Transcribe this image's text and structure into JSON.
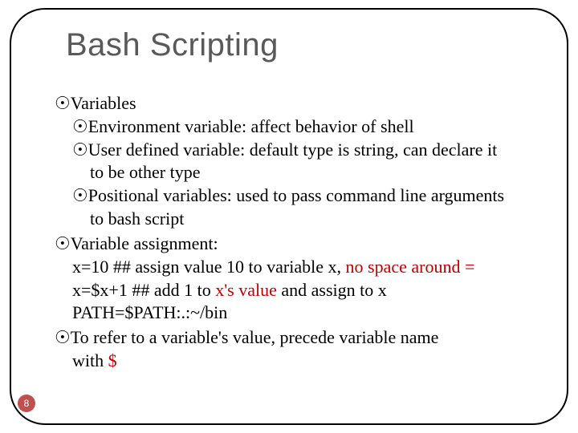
{
  "title": "Bash Scripting",
  "page_number": "8",
  "bullets": {
    "variables": {
      "label": "Variables",
      "env": "Environment variable: affect behavior of shell",
      "user_a": "User defined variable: default type is string, can declare it",
      "user_b": "to be other type",
      "pos_a": "Positional variables: used to pass command line arguments",
      "pos_b": "to bash script"
    },
    "assignment": {
      "label": "Variable assignment:",
      "line1_a": "x=10   ## assign value 10 to variable x, ",
      "line1_b": "no space around =",
      "line2_a": "x=$x+1  ## add 1 to ",
      "line2_b": "x's value",
      "line2_c": " and assign to x",
      "line3": "PATH=$PATH:.:~/bin"
    },
    "refer": {
      "a": "To refer to a variable's value,  precede variable name",
      "b_pre": "with ",
      "b_sym": "$"
    }
  },
  "glyphs": {
    "l1": "☉",
    "l2": "☉"
  }
}
